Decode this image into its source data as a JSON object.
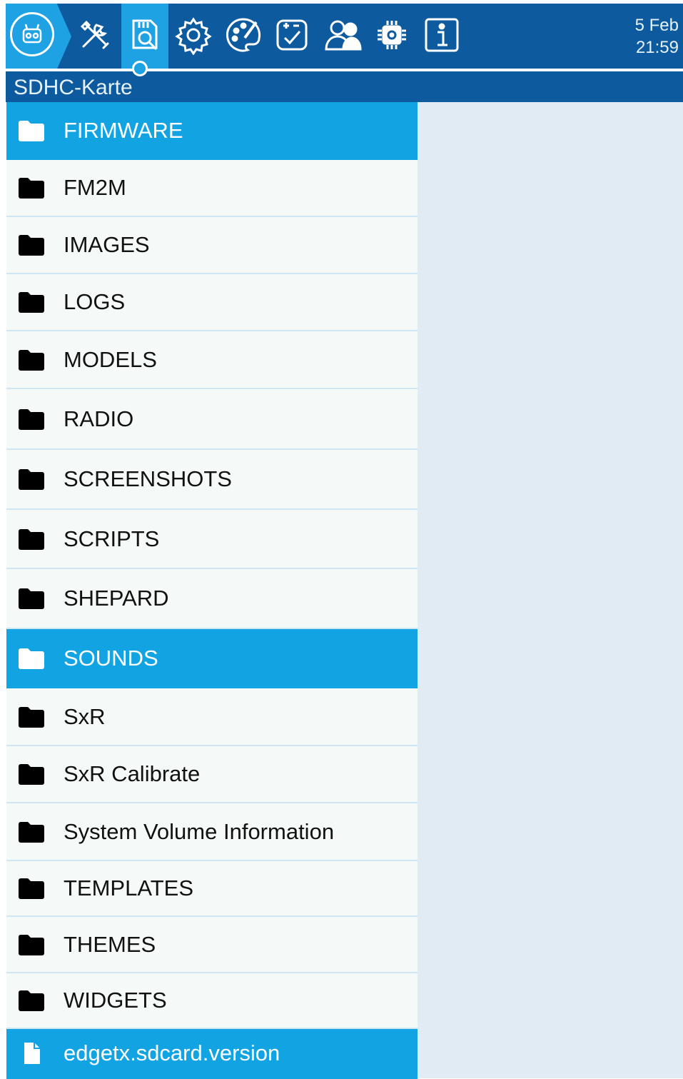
{
  "header": {
    "date": "5 Feb",
    "time": "21:59",
    "tabs": [
      {
        "name": "model-select-icon"
      },
      {
        "name": "tools-icon"
      },
      {
        "name": "sd-card-browser-icon",
        "active": true
      },
      {
        "name": "settings-gear-icon"
      },
      {
        "name": "theme-palette-icon"
      },
      {
        "name": "checklist-icon"
      },
      {
        "name": "users-icon"
      },
      {
        "name": "hardware-chip-icon"
      },
      {
        "name": "info-icon"
      }
    ]
  },
  "page": {
    "title": "SDHC-Karte"
  },
  "files": [
    {
      "label": "FIRMWARE",
      "type": "folder",
      "selected": true
    },
    {
      "label": "FM2M",
      "type": "folder"
    },
    {
      "label": "IMAGES",
      "type": "folder"
    },
    {
      "label": "LOGS",
      "type": "folder"
    },
    {
      "label": "MODELS",
      "type": "folder"
    },
    {
      "label": "RADIO",
      "type": "folder"
    },
    {
      "label": "SCREENSHOTS",
      "type": "folder"
    },
    {
      "label": "SCRIPTS",
      "type": "folder"
    },
    {
      "label": "SHEPARD",
      "type": "folder"
    },
    {
      "label": "SOUNDS",
      "type": "folder",
      "selected": true
    },
    {
      "label": "SxR",
      "type": "folder"
    },
    {
      "label": "SxR Calibrate",
      "type": "folder"
    },
    {
      "label": "System Volume Information",
      "type": "folder"
    },
    {
      "label": "TEMPLATES",
      "type": "folder"
    },
    {
      "label": "THEMES",
      "type": "folder"
    },
    {
      "label": "WIDGETS",
      "type": "folder"
    },
    {
      "label": "edgetx.sdcard.version",
      "type": "file",
      "selected": true
    }
  ],
  "colors": {
    "header": "#0d5a9e",
    "accent": "#12a3e2",
    "list_bg": "#f5f9f8",
    "panel_bg": "#e0ebf3"
  }
}
